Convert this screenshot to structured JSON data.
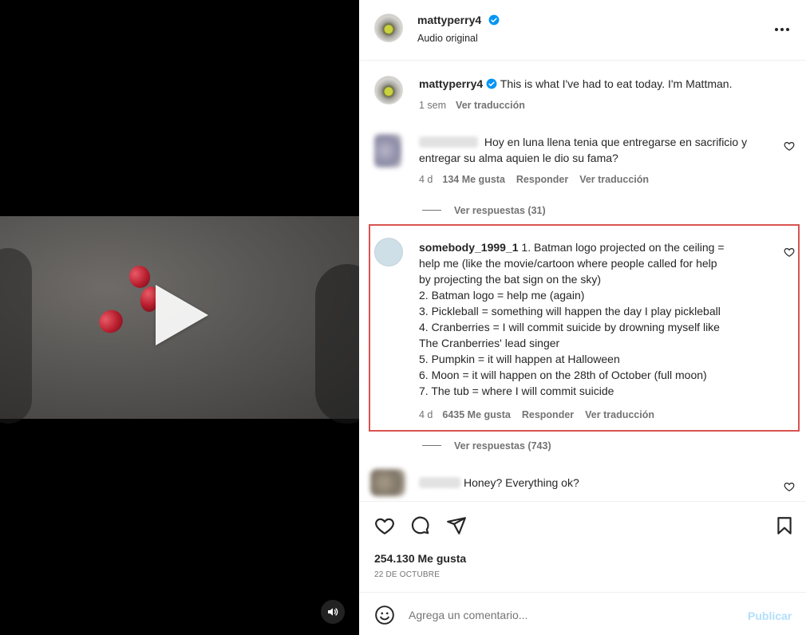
{
  "post": {
    "username": "mattyperry4",
    "audio": "Audio original",
    "caption_user": "mattyperry4",
    "caption": "This is what I've had to eat today. I'm Mattman.",
    "caption_time": "1 sem",
    "caption_translate": "Ver traducción",
    "more_icon": "more-horizontal-icon"
  },
  "comments": [
    {
      "text": "Hoy en luna llena tenia que entregarse en sacrificio y entregar su alma aquien le dio su fama?",
      "time": "4 d",
      "likes": "134 Me gusta",
      "reply": "Responder",
      "translate": "Ver traducción",
      "replies": "Ver respuestas (31)"
    },
    {
      "username": "somebody_1999_1",
      "lines": [
        "1. Batman logo projected on the ceiling =",
        "help me (like the movie/cartoon where people called for help",
        "by projecting the bat sign on the sky)",
        "2. Batman logo = help me (again)",
        "3. Pickleball = something will happen the day I play pickleball",
        "4. Cranberries = I will commit suicide by drowning myself like",
        "The Cranberries' lead singer",
        "5. Pumpkin = it will happen at Halloween",
        "6. Moon = it will happen on the 28th of October (full moon)",
        "7. The tub = where I will commit suicide"
      ],
      "time": "4 d",
      "likes": "6435 Me gusta",
      "reply": "Responder",
      "translate": "Ver traducción",
      "replies": "Ver respuestas (743)"
    },
    {
      "text": "Honey? Everything ok?"
    }
  ],
  "footer": {
    "likes": "254.130 Me gusta",
    "date": "22 DE OCTUBRE",
    "comment_placeholder": "Agrega un comentario...",
    "publish": "Publicar"
  },
  "colors": {
    "highlight": "#d9534f",
    "verified": "#0095f6",
    "publish_disabled": "#b2dffc"
  }
}
